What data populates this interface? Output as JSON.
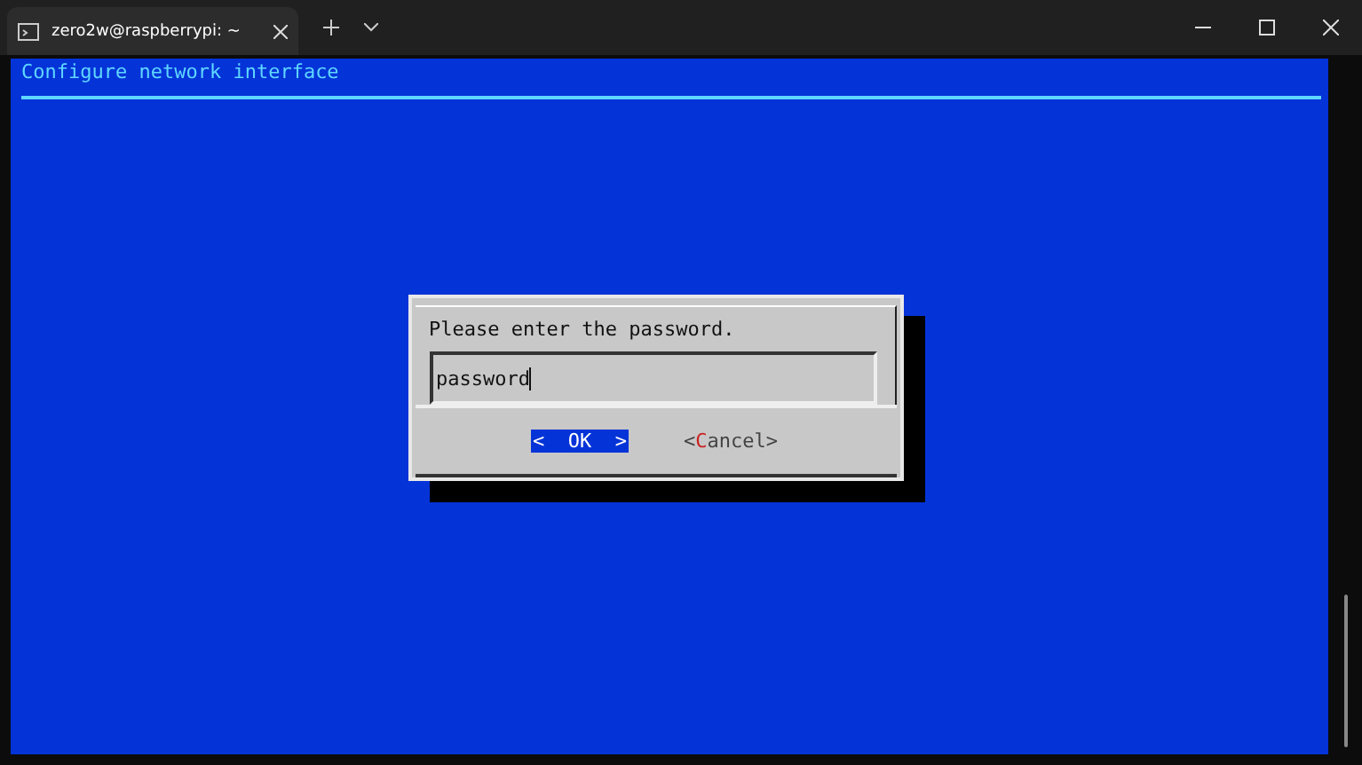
{
  "window": {
    "tab_title": "zero2w@raspberrypi: ~"
  },
  "backtitle": "Configure network interface",
  "dialog": {
    "prompt": "Please enter the password.",
    "field": {
      "value": "password"
    },
    "buttons": [
      {
        "open": "<",
        "label": "OK",
        "close": ">",
        "selected": true
      },
      {
        "open": "<",
        "hotkey": "C",
        "label": "ancel",
        "close": ">",
        "selected": false
      }
    ]
  }
}
